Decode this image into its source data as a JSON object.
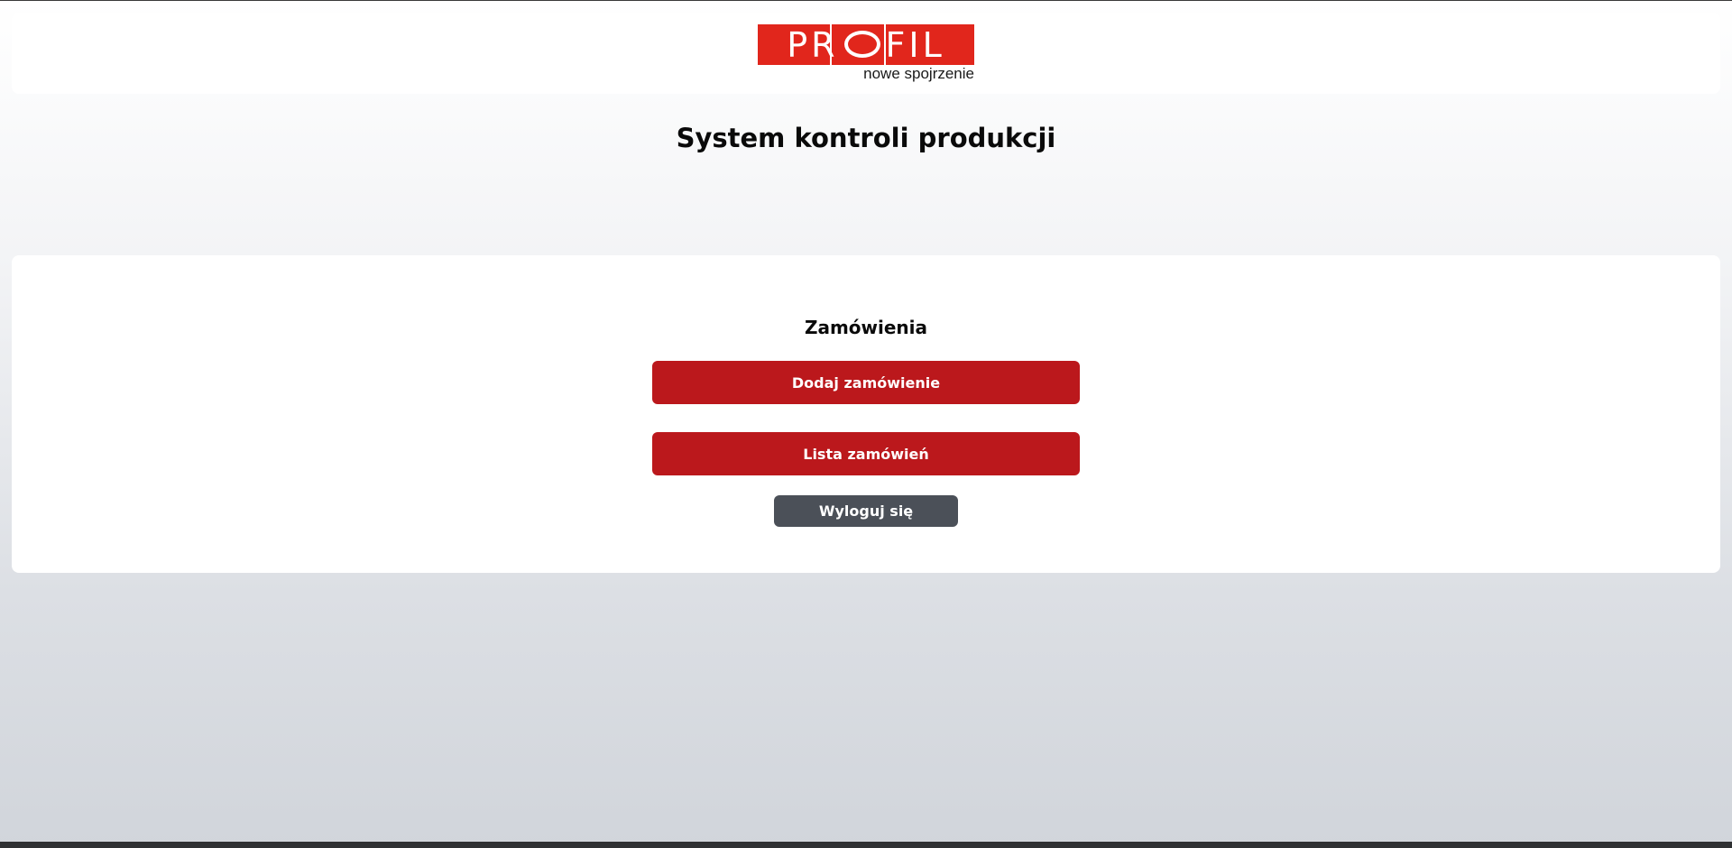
{
  "logo": {
    "brand_left": "PR",
    "brand_right": "FIL",
    "tagline": "nowe spojrzenie"
  },
  "page": {
    "title": "System kontroli produkcji"
  },
  "orders": {
    "section_title": "Zamówienia",
    "add_label": "Dodaj zamówienie",
    "list_label": "Lista zamówień",
    "logout_label": "Wyloguj się"
  },
  "colors": {
    "brand_red": "#e1261c",
    "button_red": "#bb181c",
    "button_dark": "#4b5058"
  }
}
